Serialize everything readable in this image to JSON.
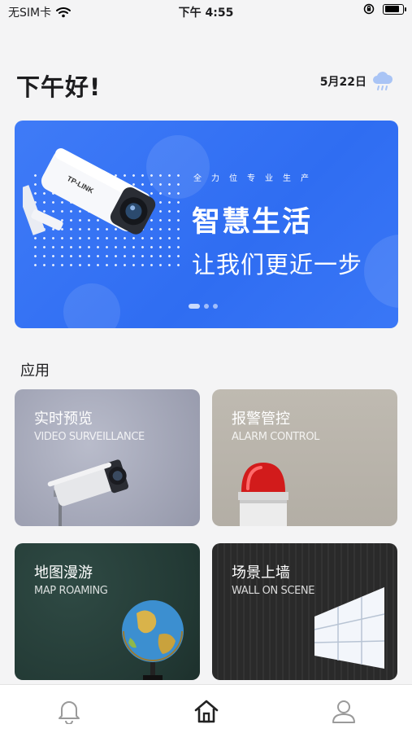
{
  "status_bar": {
    "carrier": "无SIM卡",
    "time": "下午 4:55",
    "battery_level": 0.85
  },
  "header": {
    "greeting": "下午好!",
    "date": "5月22日",
    "weather_icon": "cloud-rain-icon"
  },
  "banner": {
    "tagline": "全力位专业生产",
    "headline": "智慧生活",
    "subline": "让我们更近一步",
    "camera_brand": "TP-LINK",
    "pages": 3,
    "active_page": 1
  },
  "apps": {
    "section_title": "应用",
    "cards": [
      {
        "title": "实时预览",
        "subtitle": "VIDEO SURVEILLANCE",
        "icon": "security-camera-icon"
      },
      {
        "title": "报警管控",
        "subtitle": "ALARM CONTROL",
        "icon": "alarm-light-icon"
      },
      {
        "title": "地图漫游",
        "subtitle": "MAP ROAMING",
        "icon": "globe-icon"
      },
      {
        "title": "场景上墙",
        "subtitle": "WALL ON SCENE",
        "icon": "video-wall-icon"
      }
    ]
  },
  "tab_bar": {
    "tabs": [
      {
        "name": "notifications",
        "icon": "bell-icon"
      },
      {
        "name": "home",
        "icon": "home-icon",
        "active": true
      },
      {
        "name": "profile",
        "icon": "user-icon"
      }
    ]
  },
  "colors": {
    "banner_blue": "#3a75f5",
    "background": "#f4f4f5",
    "text": "#1d1d1f"
  }
}
